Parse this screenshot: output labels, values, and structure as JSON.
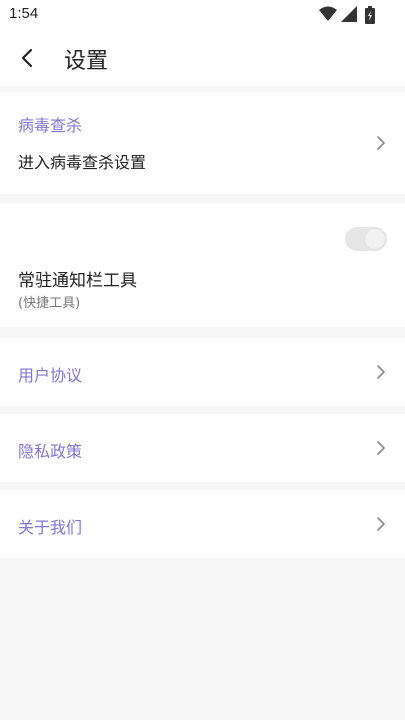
{
  "status_bar": {
    "time": "1:54",
    "icons": [
      "wifi-icon",
      "signal-icon",
      "battery-icon"
    ]
  },
  "app_bar": {
    "back_icon": "back-arrow-icon",
    "title": "设置"
  },
  "sections": {
    "virus": {
      "category": "病毒查杀",
      "item": "进入病毒查杀设置"
    },
    "notification": {
      "title": "常驻通知栏工具",
      "subtitle": "(快捷工具)",
      "toggle_on": false
    },
    "user_agreement": {
      "label": "用户协议"
    },
    "privacy_policy": {
      "label": "隐私政策"
    },
    "about_us": {
      "label": "关于我们"
    }
  },
  "colors": {
    "accent": "#8275d1",
    "background": "#f7f7f8",
    "card": "#ffffff"
  }
}
